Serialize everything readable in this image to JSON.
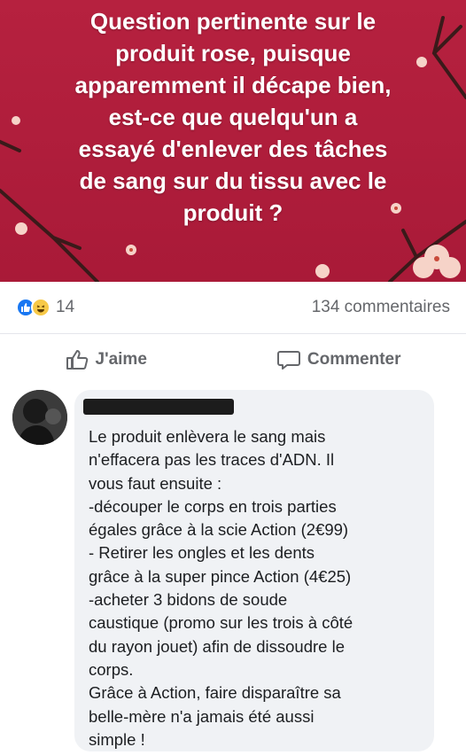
{
  "post": {
    "banner_lines": [
      "Question pertinente sur le",
      "produit rose, puisque",
      "apparemment il décape bien,",
      "est-ce que quelqu'un a",
      "essayé d'enlever des tâches",
      "de sang sur du tissu avec le",
      "produit ?"
    ],
    "banner_color": "#b01e3c"
  },
  "stats": {
    "reaction_count": "14",
    "comments": "134 commentaires",
    "reactions": [
      "like-icon",
      "haha-icon"
    ]
  },
  "actions": {
    "like_label": "J'aime",
    "comment_label": "Commenter"
  },
  "comment": {
    "author": "",
    "lines": [
      "Le produit enlèvera le sang mais",
      "n'effacera pas les traces d'ADN. Il",
      "vous faut ensuite :",
      "-découper le corps en trois parties",
      "égales grâce à la scie Action (2€99)",
      "- Retirer les ongles et les dents",
      "grâce à la super pince Action (4€25)",
      "-acheter 3 bidons de soude",
      "caustique (promo sur les trois à côté",
      "du rayon jouet) afin de dissoudre le",
      "corps.",
      "Grâce à Action, faire disparaître sa",
      "belle-mère n'a jamais été aussi",
      "simple !"
    ]
  }
}
